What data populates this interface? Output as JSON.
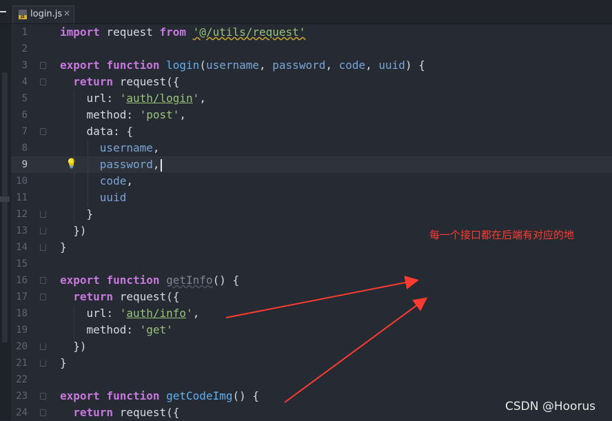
{
  "tab": {
    "filename": "login.js",
    "close_glyph": "×",
    "icon_badge": "JS"
  },
  "lines": [
    {
      "n": "1",
      "segments": [
        [
          "import",
          "kw"
        ],
        [
          " request ",
          "ident"
        ],
        [
          "from",
          "kw"
        ],
        [
          " ",
          "ident"
        ],
        [
          "'@/utils/request'",
          "str squig"
        ]
      ]
    },
    {
      "n": "2",
      "segments": []
    },
    {
      "n": "3",
      "segments": [
        [
          "export",
          "kw"
        ],
        [
          " ",
          "ident"
        ],
        [
          "function",
          "kw"
        ],
        [
          " ",
          "ident"
        ],
        [
          "login",
          "fn"
        ],
        [
          "(",
          "ident"
        ],
        [
          "username",
          "var"
        ],
        [
          ", ",
          "ident"
        ],
        [
          "password",
          "var"
        ],
        [
          ", ",
          "ident"
        ],
        [
          "code",
          "var"
        ],
        [
          ", ",
          "ident"
        ],
        [
          "uuid",
          "var"
        ],
        [
          ") {",
          "ident"
        ]
      ]
    },
    {
      "n": "4",
      "segments": [
        [
          "  ",
          "ident"
        ],
        [
          "return",
          "kw"
        ],
        [
          " request({",
          "ident"
        ]
      ]
    },
    {
      "n": "5",
      "segments": [
        [
          "    url",
          "ident"
        ],
        [
          ": ",
          "ident"
        ],
        [
          "'",
          "str"
        ],
        [
          "auth/login",
          "url"
        ],
        [
          "'",
          "str"
        ],
        [
          ",",
          "ident"
        ]
      ]
    },
    {
      "n": "6",
      "segments": [
        [
          "    method",
          "ident"
        ],
        [
          ": ",
          "ident"
        ],
        [
          "'post'",
          "str"
        ],
        [
          ",",
          "ident"
        ]
      ]
    },
    {
      "n": "7",
      "segments": [
        [
          "    data",
          "ident"
        ],
        [
          ": {",
          "ident"
        ]
      ]
    },
    {
      "n": "8",
      "segments": [
        [
          "      ",
          "ident"
        ],
        [
          "username",
          "var"
        ],
        [
          ",",
          "ident"
        ]
      ]
    },
    {
      "n": "9",
      "segments": [
        [
          "      ",
          "ident"
        ],
        [
          "password",
          "var"
        ],
        [
          ",",
          "ident"
        ]
      ]
    },
    {
      "n": "10",
      "segments": [
        [
          "      ",
          "ident"
        ],
        [
          "code",
          "var"
        ],
        [
          ",",
          "ident"
        ]
      ]
    },
    {
      "n": "11",
      "segments": [
        [
          "      ",
          "ident"
        ],
        [
          "uuid",
          "var"
        ]
      ]
    },
    {
      "n": "12",
      "segments": [
        [
          "    }",
          "ident"
        ]
      ]
    },
    {
      "n": "13",
      "segments": [
        [
          "  })",
          "ident"
        ]
      ]
    },
    {
      "n": "14",
      "segments": [
        [
          "}",
          "ident"
        ]
      ]
    },
    {
      "n": "15",
      "segments": []
    },
    {
      "n": "16",
      "segments": [
        [
          "export",
          "kw"
        ],
        [
          " ",
          "ident"
        ],
        [
          "function",
          "kw"
        ],
        [
          " ",
          "ident"
        ],
        [
          "getInfo",
          "fn-dim"
        ],
        [
          "() {",
          "ident"
        ]
      ]
    },
    {
      "n": "17",
      "segments": [
        [
          "  ",
          "ident"
        ],
        [
          "return",
          "kw"
        ],
        [
          " request({",
          "ident"
        ]
      ]
    },
    {
      "n": "18",
      "segments": [
        [
          "    url",
          "ident"
        ],
        [
          ": ",
          "ident"
        ],
        [
          "'",
          "str"
        ],
        [
          "auth/info",
          "url"
        ],
        [
          "'",
          "str"
        ],
        [
          ",",
          "ident"
        ]
      ]
    },
    {
      "n": "19",
      "segments": [
        [
          "    method",
          "ident"
        ],
        [
          ": ",
          "ident"
        ],
        [
          "'get'",
          "str"
        ]
      ]
    },
    {
      "n": "20",
      "segments": [
        [
          "  })",
          "ident"
        ]
      ]
    },
    {
      "n": "21",
      "segments": [
        [
          "}",
          "ident"
        ]
      ]
    },
    {
      "n": "22",
      "segments": []
    },
    {
      "n": "23",
      "segments": [
        [
          "export",
          "kw"
        ],
        [
          " ",
          "ident"
        ],
        [
          "function",
          "kw"
        ],
        [
          " ",
          "ident"
        ],
        [
          "getCodeImg",
          "fn"
        ],
        [
          "() {",
          "ident"
        ]
      ]
    },
    {
      "n": "24",
      "segments": [
        [
          "  ",
          "ident"
        ],
        [
          "return",
          "kw"
        ],
        [
          " request({",
          "ident"
        ]
      ]
    }
  ],
  "current_line": "9",
  "annotation": "每一个接口都在后端有对应的地",
  "watermark": "CSDN @Hoorus",
  "colors": {
    "keyword": "#c678dd",
    "function": "#61afef",
    "string": "#98c379",
    "variable": "#7aa5d6",
    "annotation": "#ff3b30",
    "arrow": "#ff3b30"
  }
}
